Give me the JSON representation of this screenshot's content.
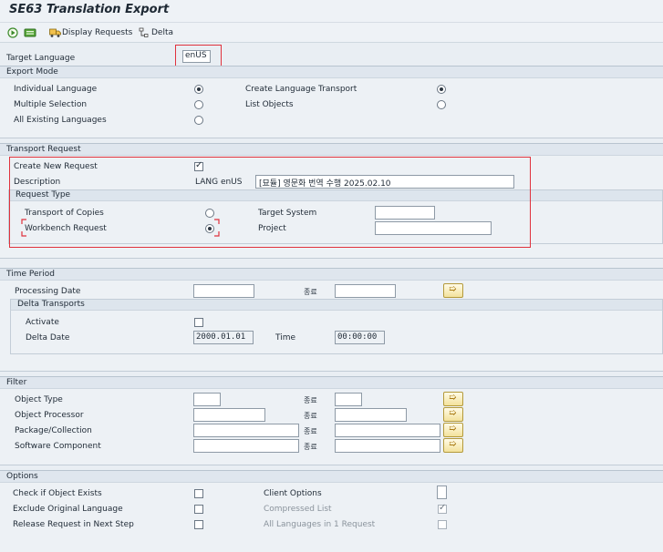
{
  "title": "SE63 Translation Export",
  "toolbar": {
    "execute_icon": "execute-icon",
    "variant_icon": "variant-icon",
    "display_requests_icon": "display-requests-icon",
    "display_requests": "Display Requests",
    "delta_icon": "delta-icon",
    "delta": "Delta"
  },
  "target_language": {
    "label": "Target Language",
    "value": "enUS"
  },
  "export_mode": {
    "header": "Export Mode",
    "individual_language": "Individual Language",
    "multiple_selection": "Multiple Selection",
    "all_existing_languages": "All Existing Languages",
    "create_language_transport": "Create Language Transport",
    "list_objects": "List Objects",
    "selected": [
      "individual_language",
      "create_language_transport"
    ]
  },
  "transport_request": {
    "header": "Transport Request",
    "create_new_request": {
      "label": "Create New Request",
      "checked": true
    },
    "description": {
      "label": "Description",
      "prefix": "LANG enUS",
      "value": "[묘듈] 영문화 번역 수행 2025.02.10"
    },
    "request_type": {
      "header": "Request Type",
      "transport_of_copies": "Transport of Copies",
      "workbench_request": "Workbench Request",
      "selected": "workbench_request",
      "target_system": {
        "label": "Target System",
        "value": ""
      },
      "project": {
        "label": "Project",
        "value": ""
      }
    }
  },
  "time_period": {
    "header": "Time Period",
    "processing_date": {
      "label": "Processing Date",
      "to_label": "종료",
      "from": "",
      "to": ""
    },
    "delta_transports": {
      "header": "Delta Transports",
      "activate": {
        "label": "Activate",
        "checked": false
      },
      "delta_date": {
        "label": "Delta Date",
        "value": "2000.01.01"
      },
      "time": {
        "label": "Time",
        "value": "00:00:00"
      }
    }
  },
  "filter": {
    "header": "Filter",
    "to_label": "종료",
    "rows": [
      {
        "label": "Object Type",
        "from": "",
        "to": ""
      },
      {
        "label": "Object Processor",
        "from": "",
        "to": ""
      },
      {
        "label": "Package/Collection",
        "from": "",
        "to": ""
      },
      {
        "label": "Software Component",
        "from": "",
        "to": ""
      }
    ]
  },
  "options": {
    "header": "Options",
    "check_if_object_exists": {
      "label": "Check if Object Exists",
      "checked": false
    },
    "exclude_original_language": {
      "label": "Exclude Original Language",
      "checked": false
    },
    "release_request_next_step": {
      "label": "Release Request in Next Step",
      "checked": false
    },
    "client_options": {
      "label": "Client Options",
      "value": ""
    },
    "compressed_list": {
      "label": "Compressed List",
      "checked": true,
      "enabled": false
    },
    "all_languages_one_request": {
      "label": "All Languages in 1 Request",
      "checked": false,
      "enabled": false
    }
  },
  "colors": {
    "highlight": "#e0323d",
    "section_header": "#dfe6ee",
    "background": "#e9eef3"
  }
}
